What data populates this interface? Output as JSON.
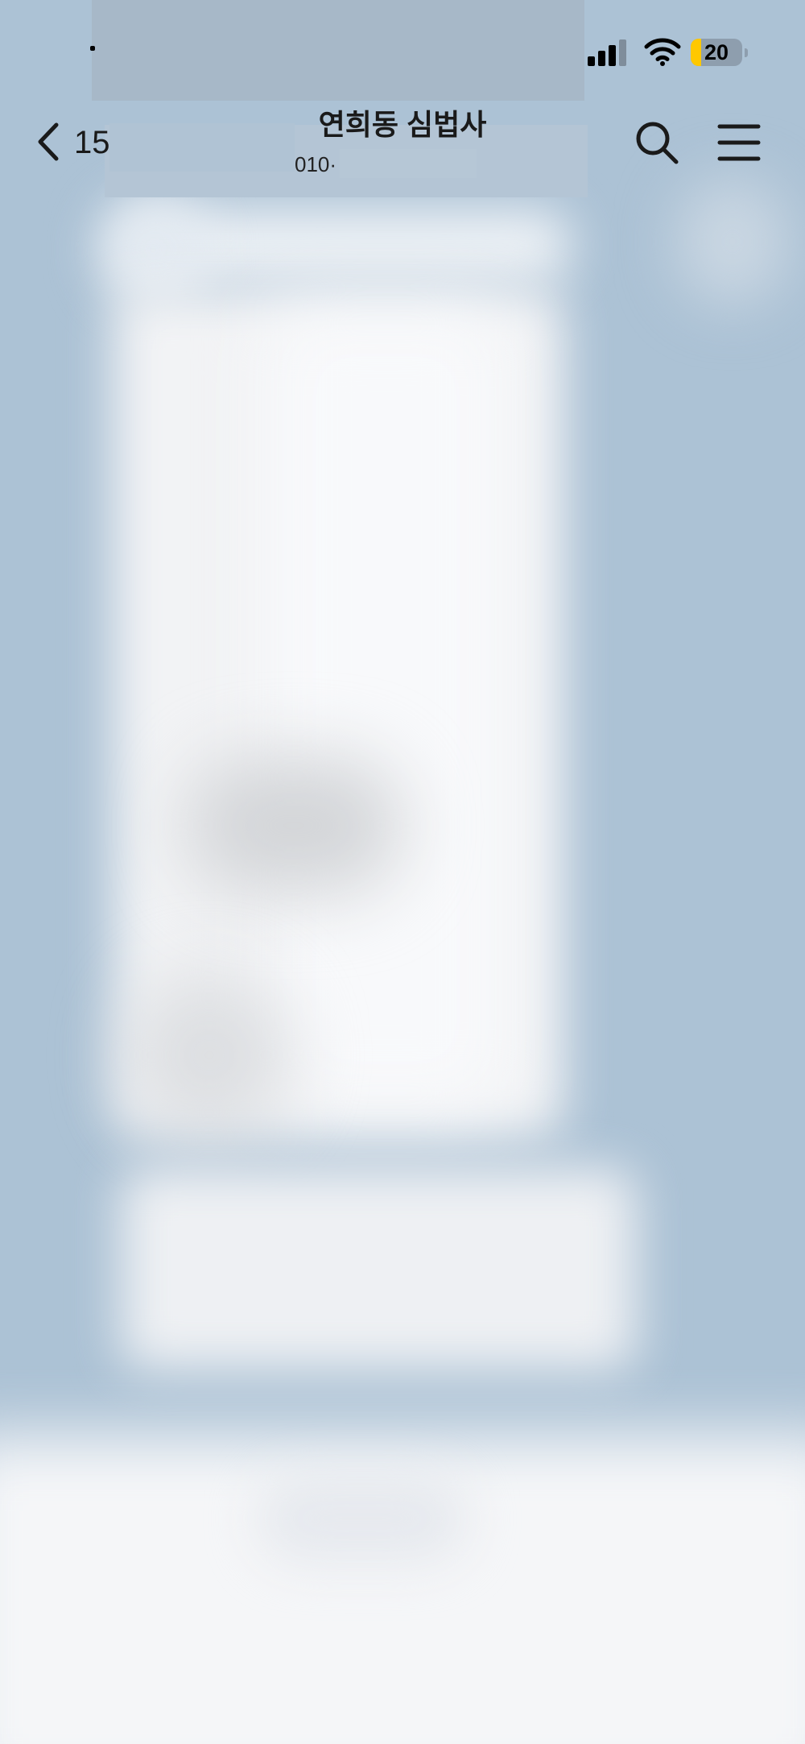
{
  "status_bar": {
    "battery_level": "20",
    "battery_fraction": 0.2,
    "battery_color": "#ffc800",
    "signal_icon": "cellular-signal-icon",
    "wifi_icon": "wifi-icon"
  },
  "nav": {
    "back_icon": "chevron-left-icon",
    "unread_count": "15",
    "title": "연희동 심법사",
    "subtitle": "010·",
    "search_icon": "search-icon",
    "menu_icon": "hamburger-menu-icon"
  },
  "colors": {
    "chat_background": "#acc2d5",
    "title_text": "#1a1a1a"
  }
}
